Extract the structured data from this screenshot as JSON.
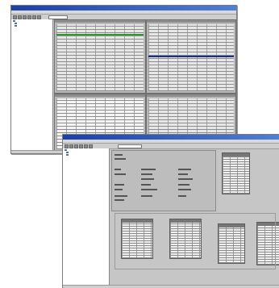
{
  "colors": {
    "accent_green": "#2f9a2f",
    "accent_blue": "#1b2f8c",
    "titlebar": "#1c3fa8",
    "window_bg": "#c6c6c6"
  },
  "back_window": {
    "title": "",
    "tree_items": [
      "",
      "",
      ""
    ],
    "icons": [
      "folder-icon",
      "document-icon"
    ]
  },
  "front_window": {
    "title": "",
    "tree_items": [
      "",
      "",
      ""
    ],
    "icons": [
      "folder-icon",
      "document-icon"
    ]
  }
}
